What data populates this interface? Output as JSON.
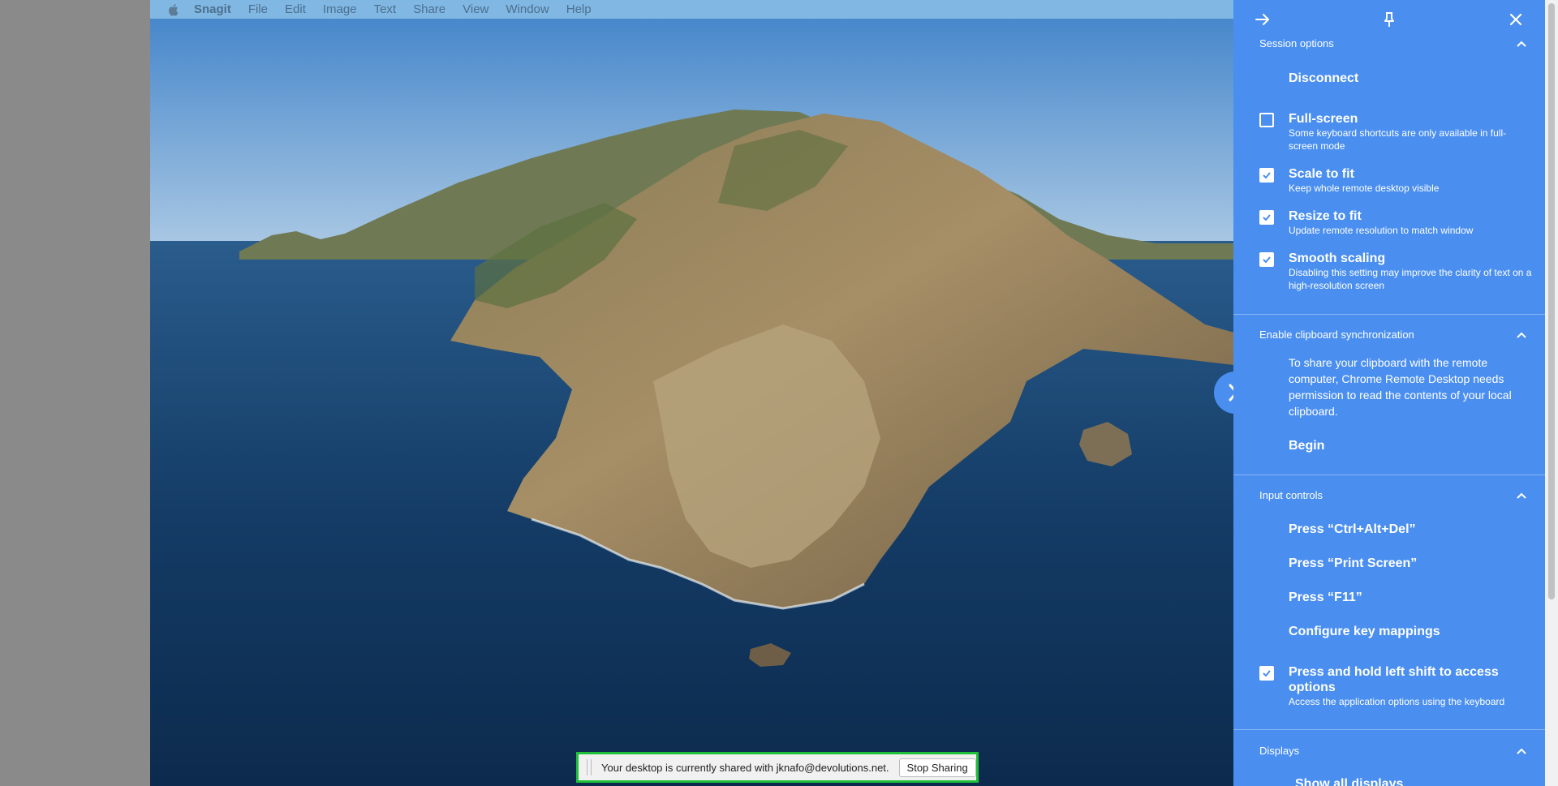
{
  "menubar": {
    "app": "Snagit",
    "items": [
      "File",
      "Edit",
      "Image",
      "Text",
      "Share",
      "View",
      "Window",
      "Help"
    ]
  },
  "sharebar": {
    "message": "Your desktop is currently shared with jknafo@devolutions.net.",
    "stop_label": "Stop Sharing"
  },
  "panel": {
    "session": {
      "header": "Session options",
      "disconnect": "Disconnect",
      "options": [
        {
          "title": "Full-screen",
          "desc": "Some keyboard shortcuts are only available in full-screen mode",
          "checked": false
        },
        {
          "title": "Scale to fit",
          "desc": "Keep whole remote desktop visible",
          "checked": true
        },
        {
          "title": "Resize to fit",
          "desc": "Update remote resolution to match window",
          "checked": true
        },
        {
          "title": "Smooth scaling",
          "desc": "Disabling this setting may improve the clarity of text on a high-resolution screen",
          "checked": true
        }
      ]
    },
    "clipboard": {
      "header": "Enable clipboard synchronization",
      "text": "To share your clipboard with the remote computer, Chrome Remote Desktop needs permission to read the contents of your local clipboard.",
      "begin": "Begin"
    },
    "input": {
      "header": "Input controls",
      "ctrl_alt_del": "Press “Ctrl+Alt+Del”",
      "print_screen": "Press “Print Screen”",
      "f11": "Press “F11”",
      "key_mappings": "Configure key mappings",
      "shift_option": {
        "title": "Press and hold left shift to access options",
        "desc": "Access the application options using the keyboard",
        "checked": true
      }
    },
    "displays": {
      "header": "Displays",
      "show_all": "Show all displays"
    }
  }
}
